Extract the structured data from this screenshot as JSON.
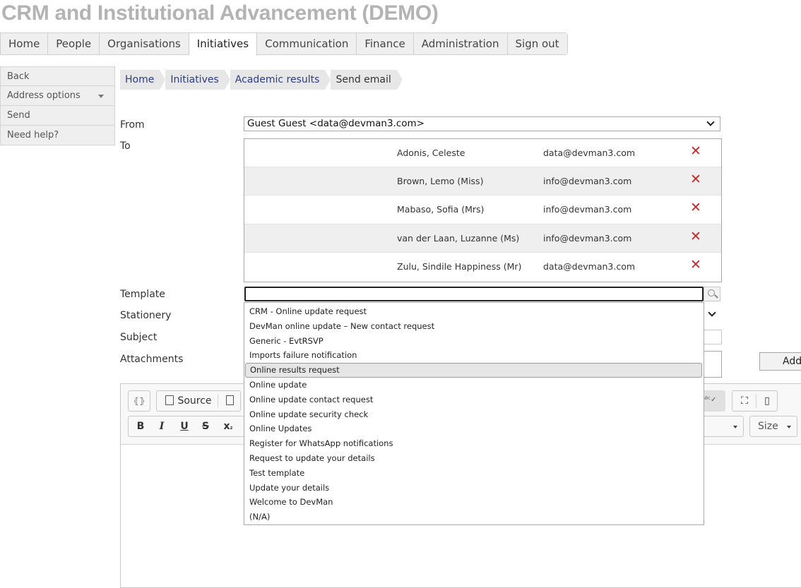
{
  "app": {
    "title": "CRM and Institutional Advancement (DEMO)"
  },
  "nav": {
    "tabs": [
      {
        "label": "Home"
      },
      {
        "label": "People"
      },
      {
        "label": "Organisations"
      },
      {
        "label": "Initiatives"
      },
      {
        "label": "Communication"
      },
      {
        "label": "Finance"
      },
      {
        "label": "Administration"
      },
      {
        "label": "Sign out"
      }
    ],
    "active": "Initiatives"
  },
  "sidebar": {
    "items": [
      {
        "label": "Back"
      },
      {
        "label": "Address options"
      },
      {
        "label": "Send"
      },
      {
        "label": "Need help?"
      }
    ]
  },
  "breadcrumb": [
    "Home",
    "Initiatives",
    "Academic results",
    "Send email"
  ],
  "form": {
    "from_label": "From",
    "from_value": "Guest Guest <data@devman3.com>",
    "to_label": "To",
    "recipients": [
      {
        "name": "Adonis, Celeste",
        "email": "data@devman3.com"
      },
      {
        "name": "Brown, Lemo (Miss)",
        "email": "info@devman3.com"
      },
      {
        "name": "Mabaso, Sofia (Mrs)",
        "email": "info@devman3.com"
      },
      {
        "name": "van der Laan, Luzanne (Ms)",
        "email": "info@devman3.com"
      },
      {
        "name": "Zulu, Sindile Happiness (Mr)",
        "email": "data@devman3.com"
      }
    ],
    "template_label": "Template",
    "template_value": "",
    "stationery_label": "Stationery",
    "subject_label": "Subject",
    "attachments_label": "Attachments",
    "add_label": "Add"
  },
  "editor": {
    "toolbar": {
      "source_label": "Source",
      "size_label": "Size"
    }
  },
  "template_dropdown": {
    "options": [
      "CRM - Online update request",
      "DevMan online update – New contact request",
      "Generic - EvtRSVP",
      "Imports failure notification",
      "Online results request",
      "Online update",
      "Online update contact request",
      "Online update security check",
      "Online Updates",
      "Register for WhatsApp notifications",
      "Request to update your details",
      "Test template",
      "Update your details",
      "Welcome to DevMan",
      "(N/A)"
    ],
    "highlighted": "Online results request"
  },
  "colors": {
    "delete_icon": "#c62828",
    "link": "#2a3c8a",
    "title": "#b3b3b3"
  }
}
